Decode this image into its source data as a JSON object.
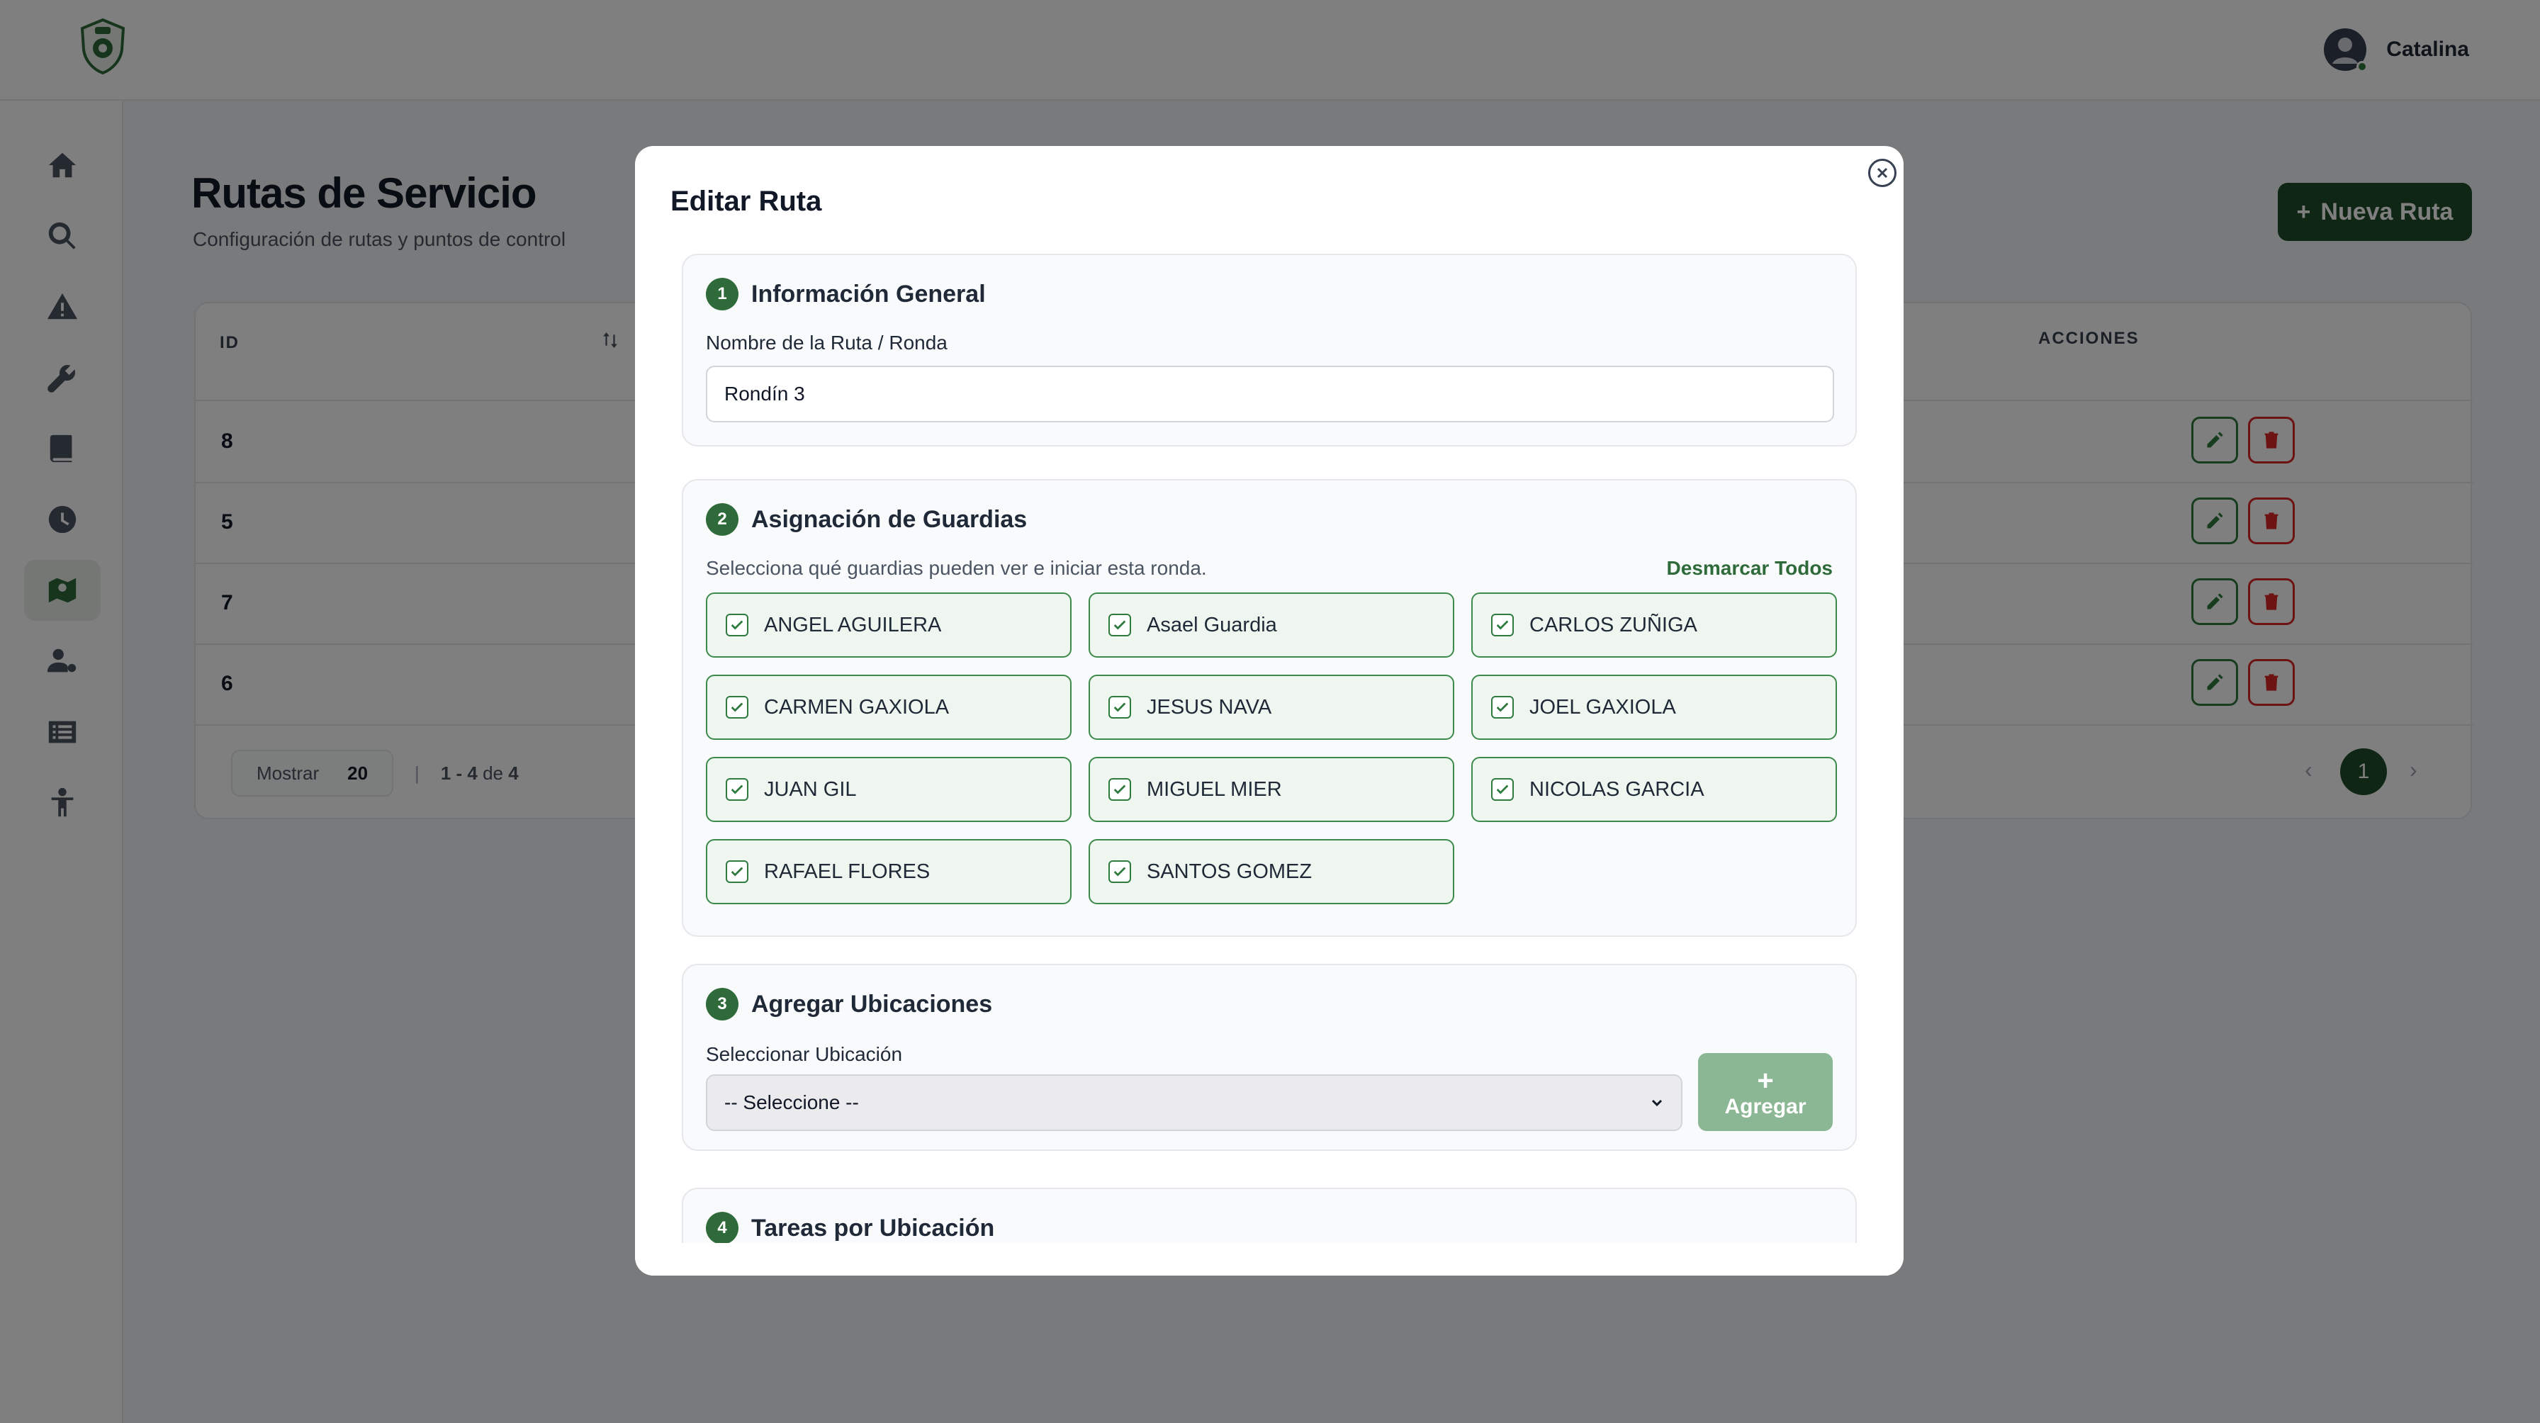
{
  "user": {
    "name": "Catalina"
  },
  "page": {
    "title": "Rutas de Servicio",
    "subtitle": "Configuración de rutas y puntos de control",
    "new_button": "Nueva Ruta"
  },
  "table": {
    "headers": {
      "id": "ID",
      "actions": "ACCIONES"
    },
    "rows": [
      {
        "id": "8"
      },
      {
        "id": "5"
      },
      {
        "id": "7"
      },
      {
        "id": "6"
      }
    ],
    "pager": {
      "show_label": "Mostrar",
      "page_size": "20",
      "range": "1 - 4",
      "of": "de",
      "total": "4",
      "current_page": "1"
    }
  },
  "modal": {
    "title": "Editar Ruta",
    "section1": {
      "number": "1",
      "title": "Información General",
      "label": "Nombre de la Ruta / Ronda",
      "value": "Rondín 3"
    },
    "section2": {
      "number": "2",
      "title": "Asignación de Guardias",
      "helper": "Selecciona qué guardias pueden ver e iniciar esta ronda.",
      "unmark_all": "Desmarcar Todos",
      "guards": [
        {
          "name": "ANGEL AGUILERA",
          "checked": true
        },
        {
          "name": "Asael Guardia",
          "checked": true
        },
        {
          "name": "CARLOS ZUÑIGA",
          "checked": true
        },
        {
          "name": "CARMEN GAXIOLA",
          "checked": true
        },
        {
          "name": "JESUS NAVA",
          "checked": true
        },
        {
          "name": "JOEL GAXIOLA",
          "checked": true
        },
        {
          "name": "JUAN GIL",
          "checked": true
        },
        {
          "name": "MIGUEL MIER",
          "checked": true
        },
        {
          "name": "NICOLAS GARCIA",
          "checked": true
        },
        {
          "name": "RAFAEL FLORES",
          "checked": true
        },
        {
          "name": "SANTOS GOMEZ",
          "checked": true
        }
      ]
    },
    "section3": {
      "number": "3",
      "title": "Agregar Ubicaciones",
      "label": "Seleccionar Ubicación",
      "select_value": "-- Seleccione --",
      "add_button": "Agregar"
    },
    "section4": {
      "number": "4",
      "title": "Tareas por Ubicación"
    }
  },
  "colors": {
    "primary": "#1f4d2b",
    "accent": "#2f7a3d",
    "danger": "#dc2626"
  }
}
